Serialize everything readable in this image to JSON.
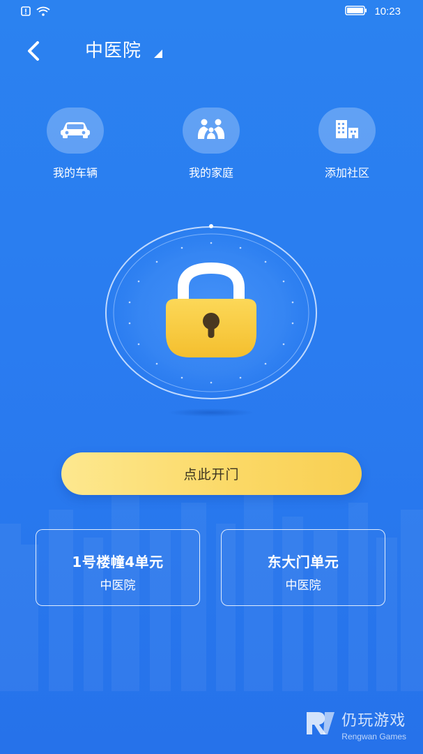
{
  "status_bar": {
    "time": "10:23",
    "icons": [
      "alert-icon",
      "wifi-icon",
      "battery-icon"
    ]
  },
  "header": {
    "title": "中医院",
    "back_icon": "chevron-left-icon",
    "dropdown_icon": "caret-down-icon"
  },
  "quick_actions": [
    {
      "label": "我的车辆",
      "icon": "car-icon"
    },
    {
      "label": "我的家庭",
      "icon": "family-icon"
    },
    {
      "label": "添加社区",
      "icon": "building-icon"
    }
  ],
  "lock": {
    "icon": "padlock-icon"
  },
  "open_door_label": "点此开门",
  "doors": [
    {
      "name": "1号楼幢4单元",
      "place": "中医院"
    },
    {
      "name": "东大门单元",
      "place": "中医院"
    }
  ],
  "watermark": {
    "title": "仍玩游戏",
    "subtitle": "Rengwan Games"
  },
  "colors": {
    "background": "#2a7cf0",
    "button_yellow": "#fbd865",
    "lock_body": "#f8c83c"
  }
}
